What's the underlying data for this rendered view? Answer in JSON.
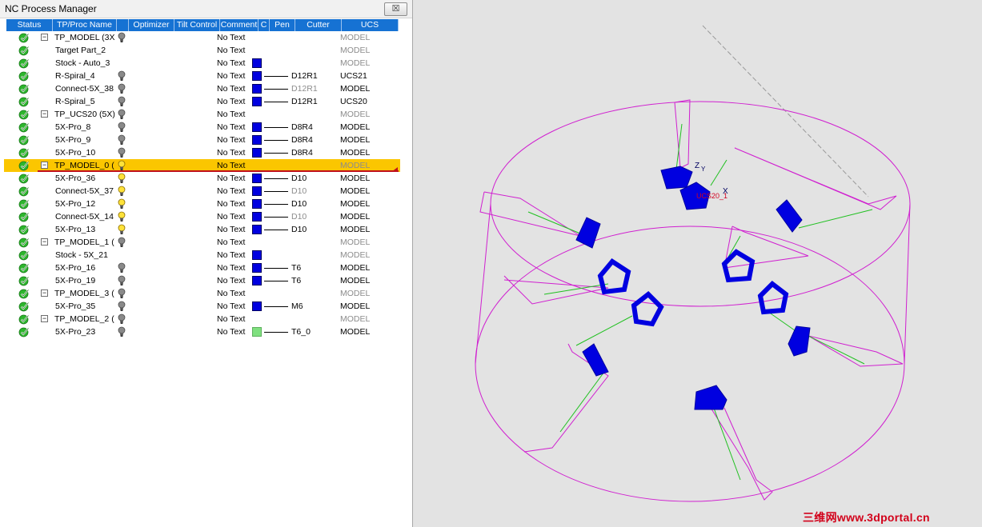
{
  "window": {
    "title": "NC Process Manager",
    "close_glyph": "☒"
  },
  "columns": [
    "Status",
    "TP/Proc Name",
    "",
    "Optimizer",
    "Tilt Control",
    "Comment",
    "C",
    "Pen",
    "Cutter",
    "UCS"
  ],
  "rows": [
    {
      "name": "TP_MODEL (3X",
      "indent": 0,
      "expander": "−",
      "bulb": "gray",
      "comment": "No Text",
      "color": "",
      "pen": false,
      "cutter": "",
      "cutter_dim": false,
      "ucs": "MODEL",
      "ucs_dim": true
    },
    {
      "name": "Target Part_2",
      "indent": 1,
      "expander": "",
      "bulb": "",
      "comment": "No Text",
      "color": "",
      "pen": false,
      "cutter": "",
      "cutter_dim": false,
      "ucs": "MODEL",
      "ucs_dim": true
    },
    {
      "name": "Stock - Auto_3",
      "indent": 1,
      "expander": "",
      "bulb": "",
      "comment": "No Text",
      "color": "#0000e0",
      "pen": false,
      "cutter": "",
      "cutter_dim": false,
      "ucs": "MODEL",
      "ucs_dim": true
    },
    {
      "name": "R-Spiral_4",
      "indent": 1,
      "expander": "",
      "bulb": "gray",
      "comment": "No Text",
      "color": "#0000e0",
      "pen": true,
      "cutter": "D12R1",
      "cutter_dim": false,
      "ucs": "UCS21",
      "ucs_dim": false
    },
    {
      "name": "Connect-5X_38",
      "indent": 1,
      "expander": "",
      "bulb": "gray",
      "comment": "No Text",
      "color": "#0000e0",
      "pen": true,
      "cutter": "D12R1",
      "cutter_dim": true,
      "ucs": "MODEL",
      "ucs_dim": false
    },
    {
      "name": "R-Spiral_5",
      "indent": 1,
      "expander": "",
      "bulb": "gray",
      "comment": "No Text",
      "color": "#0000e0",
      "pen": true,
      "cutter": "D12R1",
      "cutter_dim": false,
      "ucs": "UCS20",
      "ucs_dim": false
    },
    {
      "name": "TP_UCS20 (5X)",
      "indent": 0,
      "expander": "−",
      "bulb": "gray",
      "comment": "No Text",
      "color": "",
      "pen": false,
      "cutter": "",
      "cutter_dim": false,
      "ucs": "MODEL",
      "ucs_dim": true
    },
    {
      "name": "5X-Pro_8",
      "indent": 1,
      "expander": "",
      "bulb": "gray",
      "comment": "No Text",
      "color": "#0000e0",
      "pen": true,
      "cutter": "D8R4",
      "cutter_dim": false,
      "ucs": "MODEL",
      "ucs_dim": false
    },
    {
      "name": "5X-Pro_9",
      "indent": 1,
      "expander": "",
      "bulb": "gray",
      "comment": "No Text",
      "color": "#0000e0",
      "pen": true,
      "cutter": "D8R4",
      "cutter_dim": false,
      "ucs": "MODEL",
      "ucs_dim": false
    },
    {
      "name": "5X-Pro_10",
      "indent": 1,
      "expander": "",
      "bulb": "gray",
      "comment": "No Text",
      "color": "#0000e0",
      "pen": true,
      "cutter": "D8R4",
      "cutter_dim": false,
      "ucs": "MODEL",
      "ucs_dim": false
    },
    {
      "name": "TP_MODEL_0 (",
      "indent": 0,
      "expander": "−",
      "bulb": "yellow",
      "comment": "No Text",
      "color": "",
      "pen": false,
      "cutter": "",
      "cutter_dim": false,
      "ucs": "MODEL",
      "ucs_dim": true,
      "selected": true
    },
    {
      "name": "5X-Pro_36",
      "indent": 1,
      "expander": "",
      "bulb": "yellow",
      "comment": "No Text",
      "color": "#0000e0",
      "pen": true,
      "cutter": "D10",
      "cutter_dim": false,
      "ucs": "MODEL",
      "ucs_dim": false
    },
    {
      "name": "Connect-5X_37",
      "indent": 1,
      "expander": "",
      "bulb": "yellow",
      "comment": "No Text",
      "color": "#0000e0",
      "pen": true,
      "cutter": "D10",
      "cutter_dim": true,
      "ucs": "MODEL",
      "ucs_dim": false
    },
    {
      "name": "5X-Pro_12",
      "indent": 1,
      "expander": "",
      "bulb": "yellow",
      "comment": "No Text",
      "color": "#0000e0",
      "pen": true,
      "cutter": "D10",
      "cutter_dim": false,
      "ucs": "MODEL",
      "ucs_dim": false
    },
    {
      "name": "Connect-5X_14",
      "indent": 1,
      "expander": "",
      "bulb": "yellow",
      "comment": "No Text",
      "color": "#0000e0",
      "pen": true,
      "cutter": "D10",
      "cutter_dim": true,
      "ucs": "MODEL",
      "ucs_dim": false
    },
    {
      "name": "5X-Pro_13",
      "indent": 1,
      "expander": "",
      "bulb": "yellow",
      "comment": "No Text",
      "color": "#0000e0",
      "pen": true,
      "cutter": "D10",
      "cutter_dim": false,
      "ucs": "MODEL",
      "ucs_dim": false
    },
    {
      "name": "TP_MODEL_1 (",
      "indent": 0,
      "expander": "−",
      "bulb": "gray",
      "comment": "No Text",
      "color": "",
      "pen": false,
      "cutter": "",
      "cutter_dim": false,
      "ucs": "MODEL",
      "ucs_dim": true
    },
    {
      "name": "Stock - 5X_21",
      "indent": 1,
      "expander": "",
      "bulb": "",
      "comment": "No Text",
      "color": "#0000e0",
      "pen": false,
      "cutter": "",
      "cutter_dim": false,
      "ucs": "MODEL",
      "ucs_dim": true
    },
    {
      "name": "5X-Pro_16",
      "indent": 1,
      "expander": "",
      "bulb": "gray",
      "comment": "No Text",
      "color": "#0000e0",
      "pen": true,
      "cutter": "T6",
      "cutter_dim": false,
      "ucs": "MODEL",
      "ucs_dim": false
    },
    {
      "name": "5X-Pro_19",
      "indent": 1,
      "expander": "",
      "bulb": "gray",
      "comment": "No Text",
      "color": "#0000e0",
      "pen": true,
      "cutter": "T6",
      "cutter_dim": false,
      "ucs": "MODEL",
      "ucs_dim": false
    },
    {
      "name": "TP_MODEL_3 (",
      "indent": 0,
      "expander": "−",
      "bulb": "gray",
      "comment": "No Text",
      "color": "",
      "pen": false,
      "cutter": "",
      "cutter_dim": false,
      "ucs": "MODEL",
      "ucs_dim": true
    },
    {
      "name": "5X-Pro_35",
      "indent": 1,
      "expander": "",
      "bulb": "gray",
      "comment": "No Text",
      "color": "#0000e0",
      "pen": true,
      "cutter": "M6",
      "cutter_dim": false,
      "ucs": "MODEL",
      "ucs_dim": false
    },
    {
      "name": "TP_MODEL_2 (",
      "indent": 0,
      "expander": "−",
      "bulb": "gray",
      "comment": "No Text",
      "color": "",
      "pen": false,
      "cutter": "",
      "cutter_dim": false,
      "ucs": "MODEL",
      "ucs_dim": true
    },
    {
      "name": "5X-Pro_23",
      "indent": 1,
      "expander": "",
      "bulb": "gray",
      "comment": "No Text",
      "color": "#7fe07f",
      "pen": true,
      "cutter": "T6_0",
      "cutter_dim": false,
      "ucs": "MODEL",
      "ucs_dim": false
    }
  ],
  "viewport": {
    "ucs_label": "UCS20_1",
    "axis_z": "Z",
    "axis_y": "Y",
    "axis_x": "X"
  },
  "watermark": "三维网www.3dportal.cn",
  "colors": {
    "header_blue": "#1672d3",
    "selection": "#fbc600",
    "toolpath_blue": "#0000e0",
    "stock_magenta": "#d020d0",
    "vector_green": "#20c020",
    "status_green": "#2db52d"
  }
}
